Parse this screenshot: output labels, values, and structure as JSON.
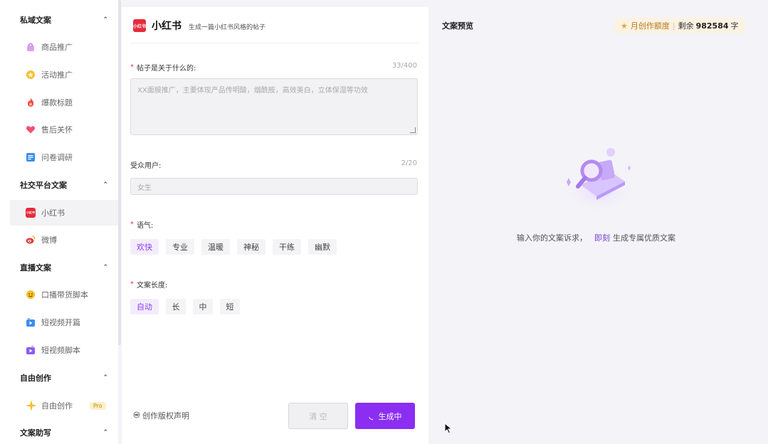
{
  "sidebar": {
    "groups": [
      {
        "title": "私域文案",
        "items": [
          {
            "label": "商品推广",
            "icon": "bag-icon"
          },
          {
            "label": "活动推广",
            "icon": "star-coin-icon"
          },
          {
            "label": "爆款标题",
            "icon": "fire-icon"
          },
          {
            "label": "售后关怀",
            "icon": "heart-icon"
          },
          {
            "label": "问卷调研",
            "icon": "document-icon"
          }
        ]
      },
      {
        "title": "社交平台文案",
        "items": [
          {
            "label": "小红书",
            "icon": "xiaohongshu-icon"
          },
          {
            "label": "微博",
            "icon": "weibo-icon"
          }
        ]
      },
      {
        "title": "直播文案",
        "items": [
          {
            "label": "口播带货脚本",
            "icon": "emoji-icon"
          },
          {
            "label": "短视频开篇",
            "icon": "video-icon"
          },
          {
            "label": "短视频脚本",
            "icon": "video-script-icon"
          }
        ]
      },
      {
        "title": "自由创作",
        "items": [
          {
            "label": "自由创作",
            "icon": "sparkle-icon",
            "badge": "Pro"
          }
        ]
      },
      {
        "title": "文案助写",
        "items": []
      }
    ]
  },
  "form": {
    "brand_logo_text": "小红书",
    "brand_name": "小红书",
    "brand_subtitle": "生成一篇小红书风格的帖子",
    "topic": {
      "label": "帖子是关于什么的:",
      "counter": "33/400",
      "value": "XX面膜推广，主要体现产品传明酸，烟酰胺，高效美白，立体保湿等功效"
    },
    "audience": {
      "label": "受众用户:",
      "counter": "2/20",
      "value": "女生"
    },
    "tone": {
      "label": "语气:",
      "options": [
        "欢快",
        "专业",
        "温暖",
        "神秘",
        "干练",
        "幽默"
      ],
      "selected": "欢快"
    },
    "length": {
      "label": "文案长度:",
      "options": [
        "自动",
        "长",
        "中",
        "短"
      ],
      "selected": "自动"
    },
    "copyright_label": "创作版权声明",
    "clear_label": "清 空",
    "generate_label": "生成中"
  },
  "preview": {
    "title": "文案预览",
    "quota_label": "月创作额度",
    "quota_remain_prefix": "剩余",
    "quota_remaining": "982584",
    "quota_unit": "字",
    "empty_prefix": "输入你的文案诉求，",
    "empty_link": "即刻",
    "empty_suffix": "生成专属优质文案"
  },
  "colors": {
    "accent": "#8b2ef2",
    "required": "#e53935",
    "brand_red": "#e62b3b"
  }
}
